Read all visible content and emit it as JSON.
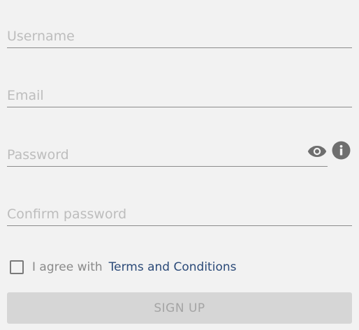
{
  "form": {
    "username": {
      "value": "",
      "placeholder": "Username"
    },
    "email": {
      "value": "",
      "placeholder": "Email"
    },
    "password": {
      "value": "",
      "placeholder": "Password"
    },
    "confirm_password": {
      "value": "",
      "placeholder": "Confirm password"
    },
    "password_icons": {
      "visibility": "eye-icon",
      "info": "info-icon"
    },
    "agree": {
      "checked": false,
      "text": "I agree with",
      "link_text": "Terms and Conditions"
    },
    "submit": {
      "label": "Sign up",
      "disabled": true
    }
  },
  "colors": {
    "background": "#f2f2f2",
    "underline": "#8c8c8c",
    "placeholder": "#bdbdbd",
    "icon": "#6e6e6e",
    "link": "#2b4a78",
    "button_bg": "#d6d6d6",
    "button_text": "#a4a4a4"
  }
}
